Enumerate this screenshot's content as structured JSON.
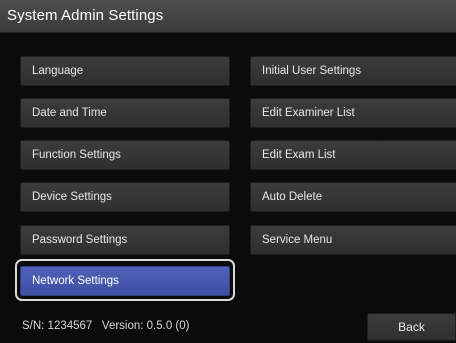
{
  "window": {
    "title": "System Admin Settings"
  },
  "menu": {
    "left": [
      {
        "label": "Language"
      },
      {
        "label": "Date and Time"
      },
      {
        "label": "Function Settings"
      },
      {
        "label": "Device Settings"
      },
      {
        "label": "Password Settings"
      },
      {
        "label": "Network Settings",
        "selected": true
      }
    ],
    "right": [
      {
        "label": "Initial User Settings"
      },
      {
        "label": "Edit Examiner List"
      },
      {
        "label": "Edit Exam List"
      },
      {
        "label": "Auto Delete"
      },
      {
        "label": "Service Menu"
      }
    ]
  },
  "footer": {
    "info": "S/N: 1234567   Version: 0.5.0 (0)",
    "back_label": "Back"
  },
  "colors": {
    "selected": "#4656ad",
    "button": "#353535",
    "title_bar": "#444444",
    "background": "#0b0b0b"
  }
}
